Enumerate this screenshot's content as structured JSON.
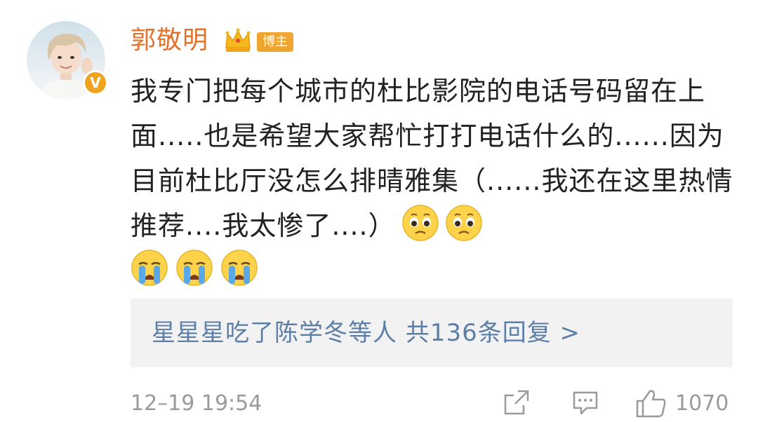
{
  "comment": {
    "author": "郭敬明",
    "author_tag": "博主",
    "text": "我专门把每个城市的杜比影院的电话号码留在上面.....也是希望大家帮忙打打电话什么的......因为目前杜比厅没怎么排晴雅集（......我还在这里热情推荐....我太惨了....）",
    "emojis_inline": [
      "pleading-face-icon",
      "pleading-face-icon"
    ],
    "emojis_row": [
      "crying-face-icon",
      "crying-face-icon",
      "crying-face-icon"
    ]
  },
  "replies": {
    "summary": "星星星吃了陈学冬等人  共136条回复 >"
  },
  "footer": {
    "timestamp": "12–19 19:54",
    "like_count": "1070"
  },
  "colors": {
    "username": "#e5722b",
    "reply_link": "#5d7fa7",
    "tag_bg": "#f0a52f",
    "meta_gray": "#9a9a9a"
  }
}
